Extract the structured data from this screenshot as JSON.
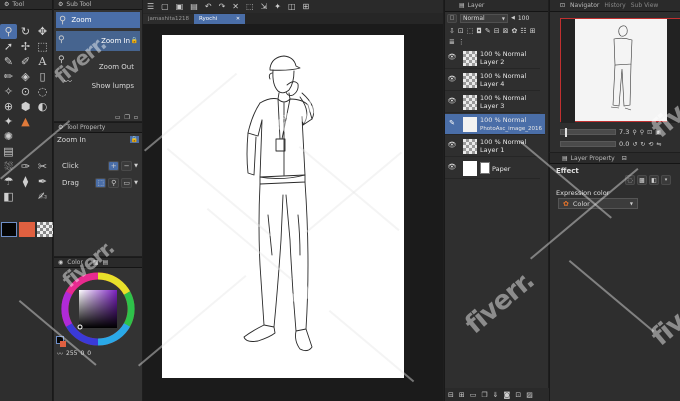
{
  "tool_panel": {
    "tab_label": "Tool"
  },
  "sub_tool": {
    "tab_label": "Sub Tool",
    "items": [
      {
        "label": "Zoom"
      },
      {
        "label": "Zoom In"
      },
      {
        "label": "Zoom Out"
      },
      {
        "label": "Show lumps"
      }
    ]
  },
  "tool_property": {
    "tab_label": "Tool Property",
    "title": "Zoom In",
    "click_label": "Click",
    "drag_label": "Drag"
  },
  "color_panel": {
    "tab_label": "Color",
    "readout": "255",
    "readout_b": "0",
    "readout_c": "0"
  },
  "canvas": {
    "tabs": [
      {
        "label": "jamashita1218"
      },
      {
        "label": "Ryochi"
      }
    ]
  },
  "layers": {
    "tab_label": "Layer",
    "blend_mode": "Normal",
    "opacity": "100",
    "rows": [
      {
        "pct": "100 % Normal",
        "name": "Layer 2"
      },
      {
        "pct": "100 % Normal",
        "name": "Layer 4"
      },
      {
        "pct": "100 % Normal",
        "name": "Layer 3"
      },
      {
        "pct": "100 % Normal",
        "name": "PhotoAsc_image_2016"
      },
      {
        "pct": "100 % Normal",
        "name": "Layer 1"
      },
      {
        "pct": "",
        "name": "Paper"
      }
    ]
  },
  "navigator": {
    "tabs": [
      {
        "label": "Navigator"
      },
      {
        "label": "History"
      },
      {
        "label": "Sub View"
      }
    ],
    "zoom": "7.3",
    "angle": "0.0"
  },
  "layer_property": {
    "tab_label": "Layer Property",
    "effect_label": "Effect",
    "expression_label": "Expression color",
    "expression_value": "Color"
  },
  "watermark": "fiverr."
}
